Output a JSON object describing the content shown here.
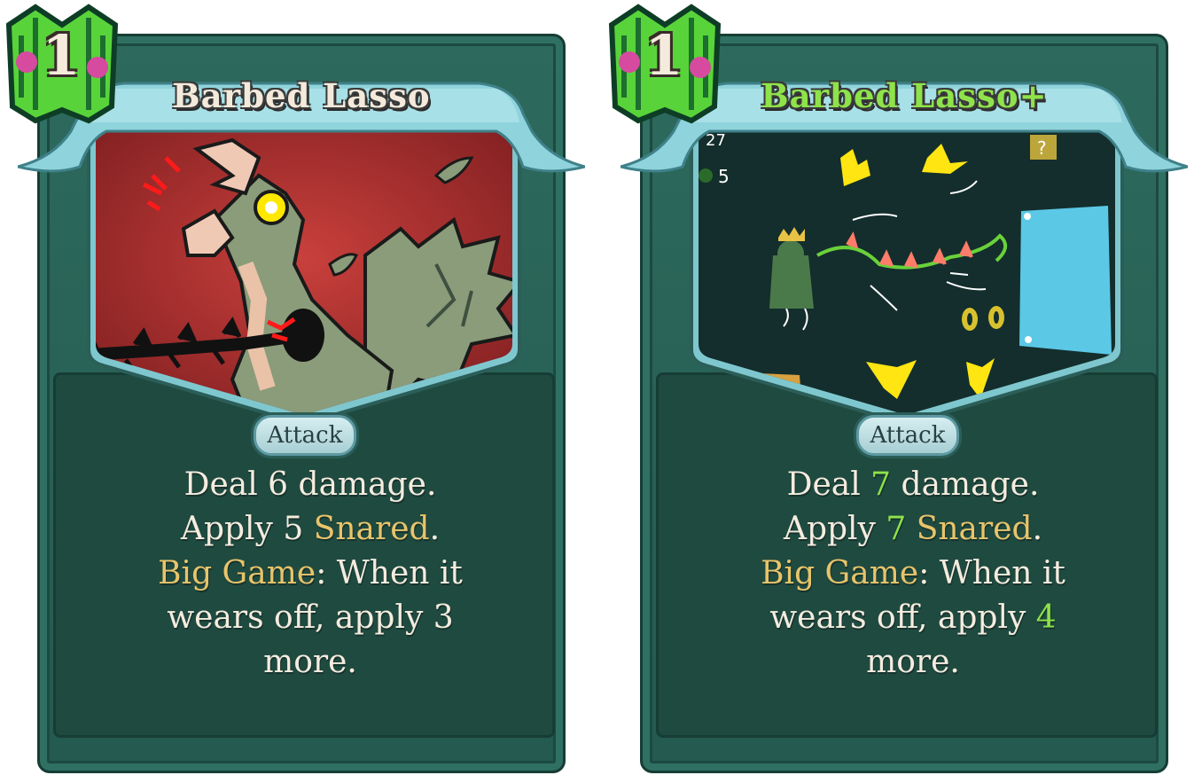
{
  "cards": [
    {
      "title": "Barbed Lasso",
      "cost": "1",
      "type": "Attack",
      "upgraded": false,
      "description": {
        "line1": {
          "pre": "Deal ",
          "value": "6",
          "post": " damage."
        },
        "line2": {
          "pre": "Apply ",
          "value": "5",
          "keyword": "Snared",
          "post": "."
        },
        "line3": {
          "keyword": "Big Game",
          "post": ": When it"
        },
        "line4": {
          "pre": "wears off, apply ",
          "value": "3"
        },
        "line5": {
          "pre": "more."
        }
      }
    },
    {
      "title": "Barbed Lasso+",
      "cost": "1",
      "type": "Attack",
      "upgraded": true,
      "art_hud": {
        "top_number": "27",
        "poison_count": "5",
        "unknown_marker": "?"
      },
      "description": {
        "line1": {
          "pre": "Deal ",
          "value": "7",
          "post": " damage."
        },
        "line2": {
          "pre": "Apply ",
          "value": "7",
          "keyword": "Snared",
          "post": "."
        },
        "line3": {
          "keyword": "Big Game",
          "post": ": When it"
        },
        "line4": {
          "pre": "wears off, apply ",
          "value": "4"
        },
        "line5": {
          "pre": "more."
        }
      }
    }
  ],
  "colors": {
    "card_frame": "#2d6a5d",
    "banner": "#8fd3dc",
    "keyword": "#e8c46a",
    "upgraded": "#8ee34a",
    "text": "#f4ecdf",
    "art_red": "#a82c2c",
    "art_dark": "#132e2c"
  },
  "icons": {
    "cost": "energy-gem-icon",
    "card_type": "attack-type-icon"
  }
}
